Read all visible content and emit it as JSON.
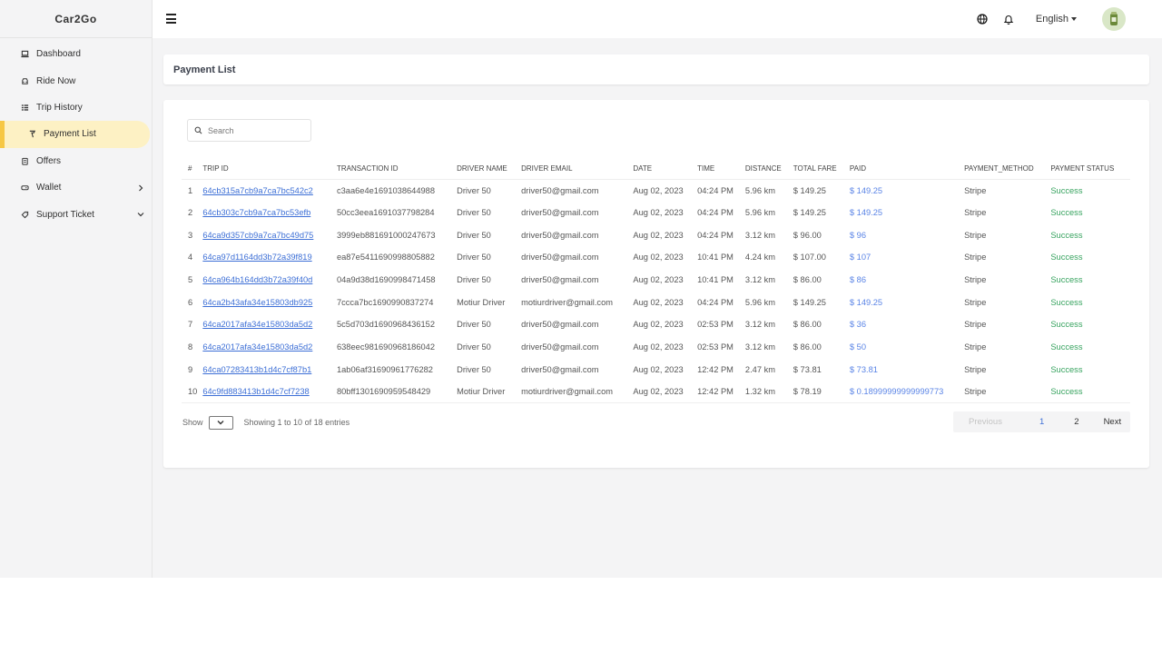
{
  "app": {
    "brand": "Car2Go"
  },
  "sidebar": {
    "items": [
      {
        "label": "Dashboard",
        "icon": "laptop-icon"
      },
      {
        "label": "Ride Now",
        "icon": "car-icon"
      },
      {
        "label": "Trip History",
        "icon": "list-icon"
      },
      {
        "label": "Payment List",
        "icon": "money-icon",
        "active": true
      },
      {
        "label": "Offers",
        "icon": "clipboard-icon"
      },
      {
        "label": "Wallet",
        "icon": "wallet-icon",
        "chevron": "right"
      },
      {
        "label": "Support Ticket",
        "icon": "tag-icon",
        "chevron": "down"
      }
    ]
  },
  "topbar": {
    "language": "English"
  },
  "page": {
    "title": "Payment List"
  },
  "search": {
    "placeholder": "Search"
  },
  "table": {
    "headers": [
      "#",
      "TRIP ID",
      "TRANSACTION ID",
      "DRIVER NAME",
      "DRIVER EMAIL",
      "DATE",
      "TIME",
      "DISTANCE",
      "TOTAL FARE",
      "PAID",
      "PAYMENT_METHOD",
      "PAYMENT STATUS"
    ],
    "rows": [
      [
        "1",
        "64cb315a7cb9a7ca7bc542c2",
        "c3aa6e4e1691038644988",
        "Driver 50",
        "driver50@gmail.com",
        "Aug 02, 2023",
        "04:24 PM",
        "5.96 km",
        "$ 149.25",
        "$ 149.25",
        "Stripe",
        "Success"
      ],
      [
        "2",
        "64cb303c7cb9a7ca7bc53efb",
        "50cc3eea1691037798284",
        "Driver 50",
        "driver50@gmail.com",
        "Aug 02, 2023",
        "04:24 PM",
        "5.96 km",
        "$ 149.25",
        "$ 149.25",
        "Stripe",
        "Success"
      ],
      [
        "3",
        "64ca9d357cb9a7ca7bc49d75",
        "3999eb881691000247673",
        "Driver 50",
        "driver50@gmail.com",
        "Aug 02, 2023",
        "04:24 PM",
        "3.12 km",
        "$ 96.00",
        "$ 96",
        "Stripe",
        "Success"
      ],
      [
        "4",
        "64ca97d1164dd3b72a39f819",
        "ea87e5411690998805882",
        "Driver 50",
        "driver50@gmail.com",
        "Aug 02, 2023",
        "10:41 PM",
        "4.24 km",
        "$ 107.00",
        "$ 107",
        "Stripe",
        "Success"
      ],
      [
        "5",
        "64ca964b164dd3b72a39f40d",
        "04a9d38d1690998471458",
        "Driver 50",
        "driver50@gmail.com",
        "Aug 02, 2023",
        "10:41 PM",
        "3.12 km",
        "$ 86.00",
        "$ 86",
        "Stripe",
        "Success"
      ],
      [
        "6",
        "64ca2b43afa34e15803db925",
        "7ccca7bc1690990837274",
        "Motiur Driver",
        "motiurdriver@gmail.com",
        "Aug 02, 2023",
        "04:24 PM",
        "5.96 km",
        "$ 149.25",
        "$ 149.25",
        "Stripe",
        "Success"
      ],
      [
        "7",
        "64ca2017afa34e15803da5d2",
        "5c5d703d1690968436152",
        "Driver 50",
        "driver50@gmail.com",
        "Aug 02, 2023",
        "02:53 PM",
        "3.12 km",
        "$ 86.00",
        "$ 36",
        "Stripe",
        "Success"
      ],
      [
        "8",
        "64ca2017afa34e15803da5d2",
        "638eec981690968186042",
        "Driver 50",
        "driver50@gmail.com",
        "Aug 02, 2023",
        "02:53 PM",
        "3.12 km",
        "$ 86.00",
        "$ 50",
        "Stripe",
        "Success"
      ],
      [
        "9",
        "64ca07283413b1d4c7cf87b1",
        "1ab06af31690961776282",
        "Driver 50",
        "driver50@gmail.com",
        "Aug 02, 2023",
        "12:42 PM",
        "2.47 km",
        "$ 73.81",
        "$ 73.81",
        "Stripe",
        "Success"
      ],
      [
        "10",
        "64c9fd883413b1d4c7cf7238",
        "80bff1301690959548429",
        "Motiur Driver",
        "motiurdriver@gmail.com",
        "Aug 02, 2023",
        "12:42 PM",
        "1.32 km",
        "$ 78.19",
        "$ 0.18999999999999773",
        "Stripe",
        "Success"
      ]
    ]
  },
  "footer": {
    "show_label": "Show",
    "entries_text": "Showing 1 to 10 of 18 entries",
    "pagination": {
      "previous": "Previous",
      "pages": [
        "1",
        "2"
      ],
      "current": "1",
      "next": "Next"
    }
  },
  "colors": {
    "accent": "#f6c744",
    "active_bg": "#fdf1c4",
    "link": "#3d6fd6",
    "success": "#37a35f"
  }
}
